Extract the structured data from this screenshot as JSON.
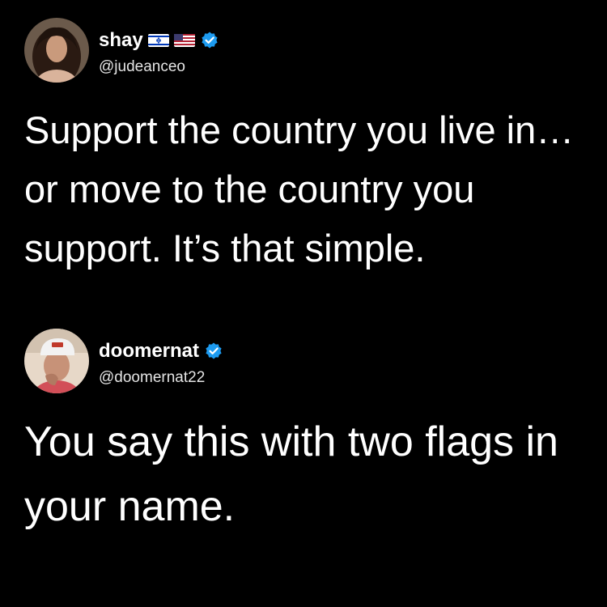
{
  "tweets": [
    {
      "display_name": "shay",
      "handle": "@judeanceo",
      "name_flags": [
        "israel-flag-icon",
        "us-flag-icon"
      ],
      "verified": true,
      "text": "Support the country you live in… or move to the country you support. It’s that simple."
    },
    {
      "display_name": "doomernat",
      "handle": "@doomernat22",
      "verified": true,
      "text": "You say this with two flags in your name."
    }
  ],
  "colors": {
    "background": "#000000",
    "text": "#ffffff",
    "verified_badge": "#1d9bf0"
  }
}
